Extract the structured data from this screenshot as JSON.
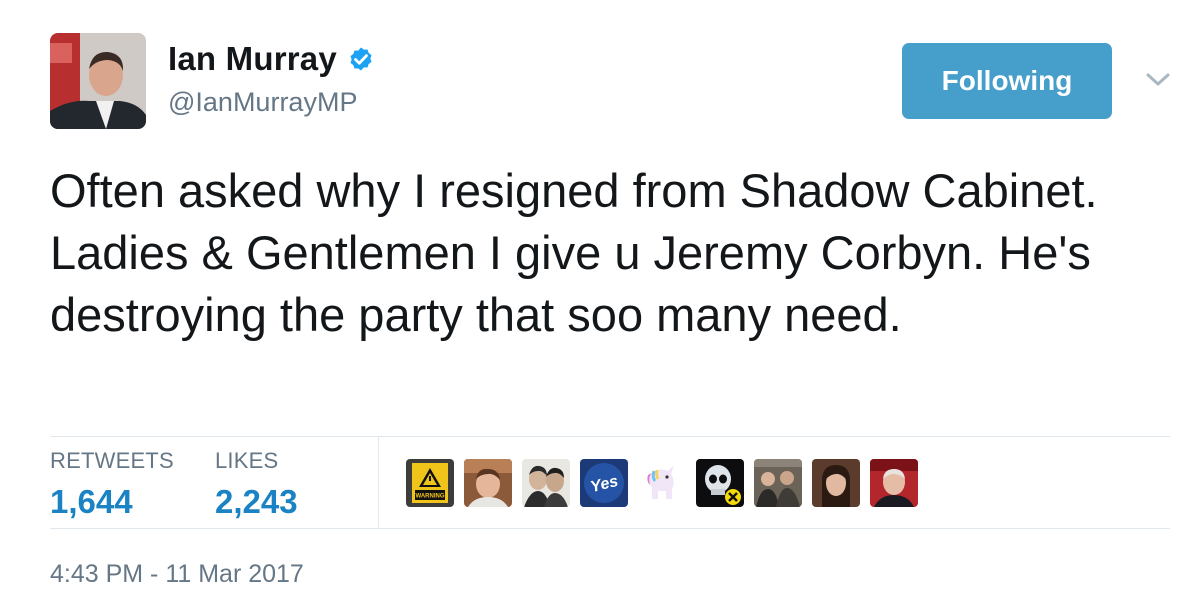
{
  "author": {
    "display_name": "Ian Murray",
    "handle": "@IanMurrayMP",
    "verified": true
  },
  "follow_button": {
    "label": "Following"
  },
  "tweet": {
    "text": "Often asked why I resigned from Shadow Cabinet. Ladies & Gentlemen I give u Jeremy Corbyn. He's destroying the party that soo many need."
  },
  "stats": {
    "retweets_label": "RETWEETS",
    "retweets_count": "1,644",
    "likes_label": "LIKES",
    "likes_count": "2,243"
  },
  "likers": [
    {
      "icon": "warning-sign-avatar",
      "caption": "WARNING"
    },
    {
      "icon": "man-photo-avatar"
    },
    {
      "icon": "cartoon-pair-avatar"
    },
    {
      "icon": "yes-campaign-avatar",
      "caption": "Yes"
    },
    {
      "icon": "unicorn-avatar"
    },
    {
      "icon": "skull-snp-avatar"
    },
    {
      "icon": "group-photo-avatar"
    },
    {
      "icon": "woman-portrait-avatar"
    },
    {
      "icon": "man-red-background-avatar"
    }
  ],
  "timestamp": "4:43 PM - 11 Mar 2017",
  "colors": {
    "follow_button_bg": "#469fca",
    "count_blue": "#1b83c3",
    "muted_gray": "#657786",
    "verified_blue": "#1da1f2"
  }
}
